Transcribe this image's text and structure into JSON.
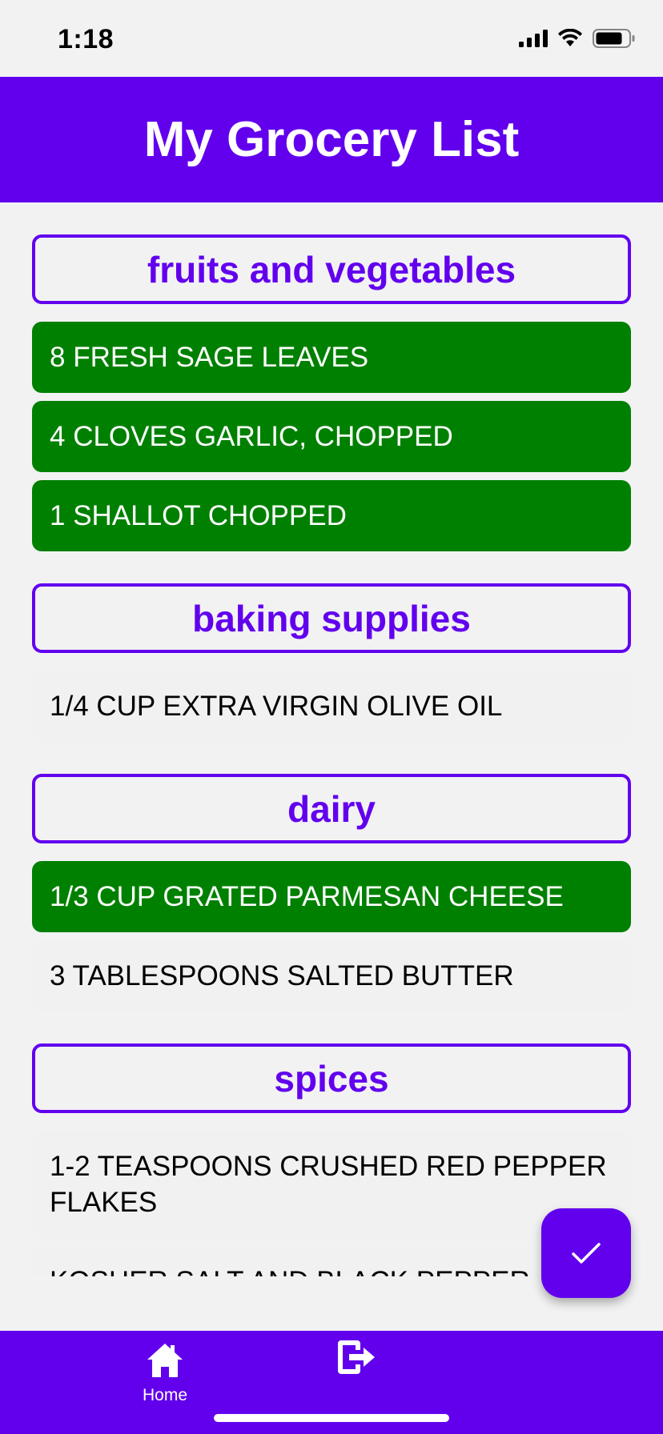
{
  "status": {
    "time": "1:18"
  },
  "header": {
    "title": "My Grocery List"
  },
  "sections": [
    {
      "title": "fruits and vegetables",
      "items": [
        {
          "text": "8 fresh sage leaves",
          "checked": true
        },
        {
          "text": "4 cloves garlic, chopped",
          "checked": true
        },
        {
          "text": "1 shallot chopped",
          "checked": true
        }
      ]
    },
    {
      "title": "baking supplies",
      "items": [
        {
          "text": "1/4 cup extra virgin olive oil",
          "checked": false
        }
      ]
    },
    {
      "title": "dairy",
      "items": [
        {
          "text": "1/3 cup grated parmesan cheese",
          "checked": true
        },
        {
          "text": "3 tablespoons salted butter",
          "checked": false
        }
      ]
    },
    {
      "title": "spices",
      "items": [
        {
          "text": "1-2 teaspoons crushed red pepper flakes",
          "checked": false
        },
        {
          "text": "kosher salt and black pepper",
          "checked": false
        }
      ]
    }
  ],
  "fab": {
    "icon": "checkmark-icon"
  },
  "bottom_nav": {
    "home_label": "Home",
    "home_icon": "home-icon",
    "logout_icon": "logout-icon"
  },
  "colors": {
    "primary": "#6200ee",
    "checked": "#008000",
    "background": "#f2f2f3"
  }
}
